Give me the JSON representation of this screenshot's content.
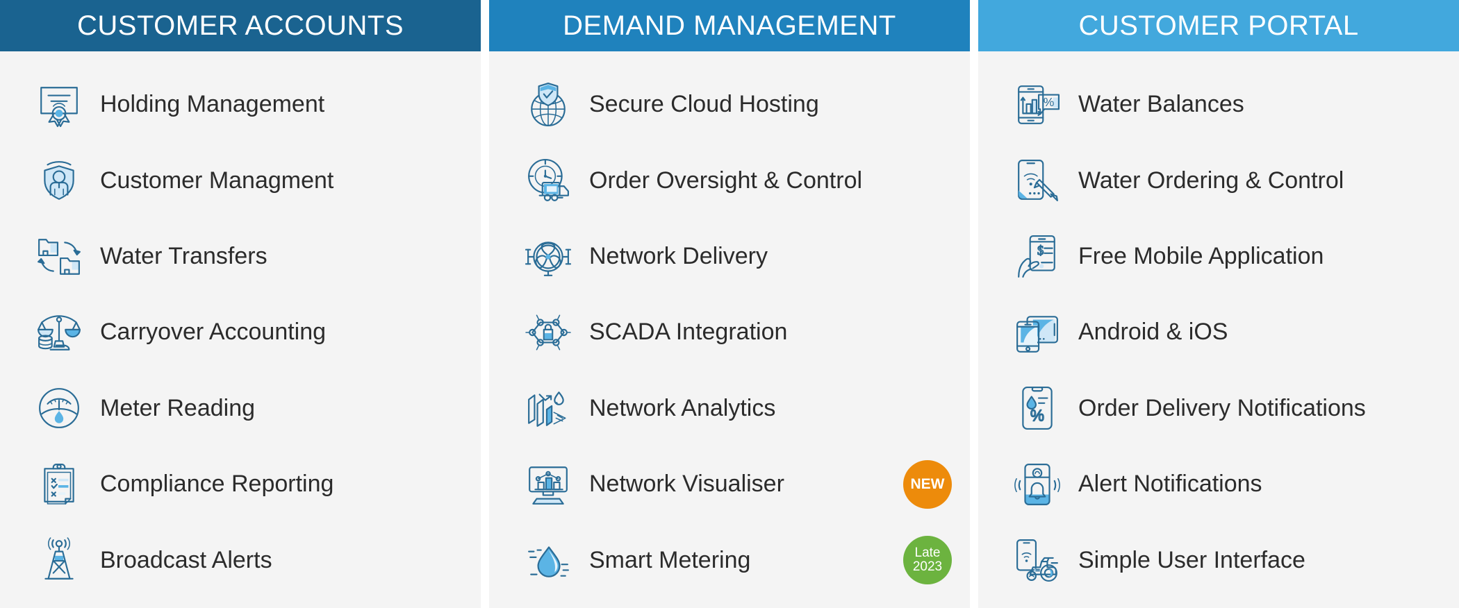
{
  "palette": {
    "header_1": "#1a6390",
    "header_2": "#1f82bd",
    "header_3": "#42a8dd",
    "panel_bg": "#f4f4f4",
    "page_bg": "#ffffff",
    "icon_stroke": "#2a6c96",
    "icon_accent": "#5bb4e5",
    "icon_accent_light": "#cfe7f7",
    "label_text": "#2b2b2b",
    "badge_new": "#ed8b0b",
    "badge_late": "#6cb33f"
  },
  "columns": [
    {
      "id": "customer-accounts",
      "title": "CUSTOMER ACCOUNTS",
      "header_color": "#1a6390",
      "items": [
        {
          "label": "Holding Management",
          "icon": "certificate-icon"
        },
        {
          "label": "Customer Managment",
          "icon": "shield-person-icon"
        },
        {
          "label": "Water Transfers",
          "icon": "folder-transfer-icon"
        },
        {
          "label": "Carryover Accounting",
          "icon": "scales-coins-icon"
        },
        {
          "label": "Meter Reading",
          "icon": "water-gauge-icon"
        },
        {
          "label": "Compliance Reporting",
          "icon": "clipboard-checklist-icon"
        },
        {
          "label": "Broadcast Alerts",
          "icon": "broadcast-tower-icon"
        }
      ]
    },
    {
      "id": "demand-management",
      "title": "DEMAND MANAGEMENT",
      "header_color": "#1f82bd",
      "items": [
        {
          "label": "Secure Cloud Hosting",
          "icon": "globe-shield-icon"
        },
        {
          "label": "Order Oversight & Control",
          "icon": "clock-truck-icon"
        },
        {
          "label": "Network Delivery",
          "icon": "valve-pipe-icon"
        },
        {
          "label": "SCADA Integration",
          "icon": "hexagon-node-lock-icon"
        },
        {
          "label": "Network Analytics",
          "icon": "bar-chart-droplet-icon"
        },
        {
          "label": "Network Visualiser",
          "icon": "monitor-chart-icon",
          "badge": {
            "lines": [
              "NEW"
            ],
            "color": "#ed8b0b"
          }
        },
        {
          "label": "Smart Metering",
          "icon": "smart-droplet-icon",
          "badge": {
            "lines": [
              "Late",
              "2023"
            ],
            "color": "#6cb33f"
          }
        }
      ]
    },
    {
      "id": "customer-portal",
      "title": "CUSTOMER PORTAL",
      "header_color": "#42a8dd",
      "items": [
        {
          "label": "Water Balances",
          "icon": "phone-chart-percent-icon"
        },
        {
          "label": "Water Ordering & Control",
          "icon": "phone-stylus-wifi-icon"
        },
        {
          "label": "Free Mobile Application",
          "icon": "hand-phone-dollar-icon"
        },
        {
          "label": "Android & iOS",
          "icon": "phone-tablet-icon"
        },
        {
          "label": "Order Delivery Notifications",
          "icon": "phone-droplet-percent-icon"
        },
        {
          "label": "Alert Notifications",
          "icon": "phone-bell-alert-icon"
        },
        {
          "label": "Simple User Interface",
          "icon": "phone-tractor-icon"
        }
      ]
    }
  ]
}
